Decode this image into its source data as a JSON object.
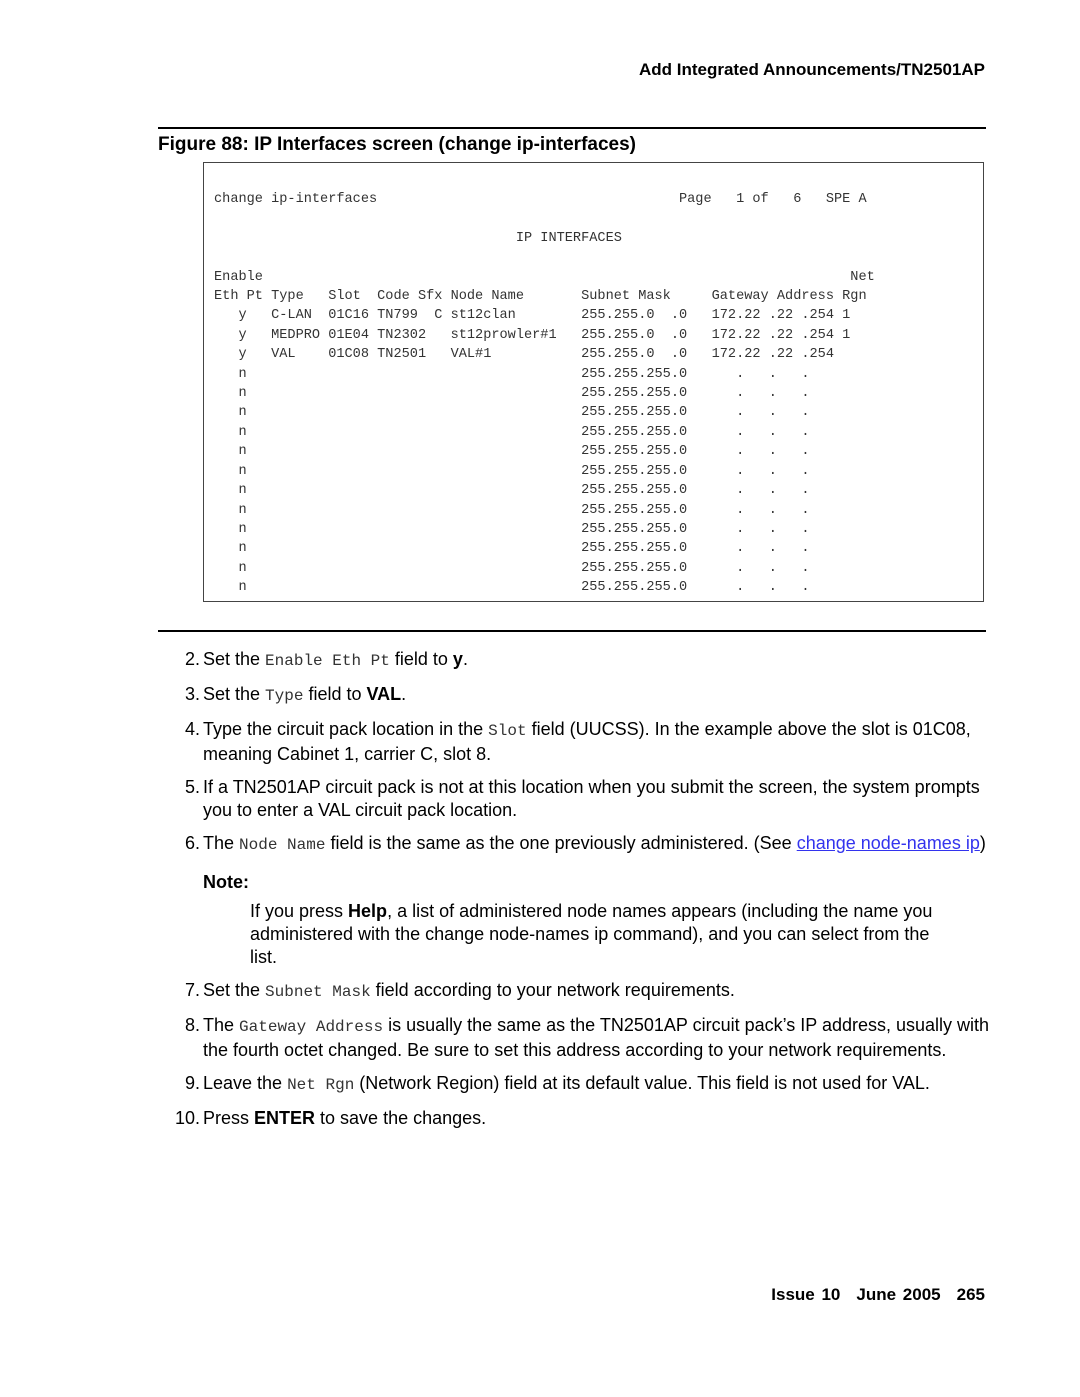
{
  "header": {
    "running_title": "Add Integrated Announcements/TN2501AP"
  },
  "figure": {
    "title": "Figure 88: IP Interfaces screen (change ip-interfaces)"
  },
  "screen": {
    "lines": [
      "change ip-interfaces                                     Page   1 of   6   SPE A",
      "",
      "                                     IP INTERFACES",
      "",
      "Enable                                                                        Net",
      "Eth Pt Type   Slot  Code Sfx Node Name       Subnet Mask     Gateway Address Rgn",
      "   y   C-LAN  01C16 TN799  C st12clan        255.255.0  .0   172.22 .22 .254 1",
      "   y   MEDPRO 01E04 TN2302   st12prowler#1   255.255.0  .0   172.22 .22 .254 1",
      "   y   VAL    01C08 TN2501   VAL#1           255.255.0  .0   172.22 .22 .254",
      "   n                                         255.255.255.0      .   .   .",
      "   n                                         255.255.255.0      .   .   .",
      "   n                                         255.255.255.0      .   .   .",
      "   n                                         255.255.255.0      .   .   .",
      "   n                                         255.255.255.0      .   .   .",
      "   n                                         255.255.255.0      .   .   .",
      "   n                                         255.255.255.0      .   .   .",
      "   n                                         255.255.255.0      .   .   .",
      "   n                                         255.255.255.0      .   .   .",
      "   n                                         255.255.255.0      .   .   .",
      "   n                                         255.255.255.0      .   .   .",
      "   n                                         255.255.255.0      .   .   ."
    ]
  },
  "steps": {
    "s2": {
      "num": "2.",
      "a": "Set the ",
      "code": "Enable Eth Pt",
      "b": " field to ",
      "bold": "y",
      "c": "."
    },
    "s3": {
      "num": "3.",
      "a": "Set the ",
      "code": "Type",
      "b": " field to ",
      "bold": "VAL",
      "c": "."
    },
    "s4": {
      "num": "4.",
      "a": "Type the circuit pack location in the ",
      "code": "Slot",
      "b": " field (UUCSS). In the example above the slot is 01C08, meaning Cabinet 1, carrier C, slot 8."
    },
    "s5": {
      "num": "5.",
      "a": "If a TN2501AP circuit pack is not at this location when you submit the screen, the system prompts you to enter a VAL circuit pack location."
    },
    "s6": {
      "num": "6.",
      "a": "The ",
      "code": "Node Name",
      "b": " field is the same as the one previously administered. (See ",
      "link": "change node-names ip",
      "c": ")"
    },
    "note": {
      "label": "Note:",
      "a": "If you press ",
      "bold": "Help",
      "b": ", a list of administered node names appears (including the name you administered with the change node-names ip command), and you can select from the list."
    },
    "s7": {
      "num": "7.",
      "a": "Set the ",
      "code": "Subnet Mask",
      "b": " field according to your network requirements."
    },
    "s8": {
      "num": "8.",
      "a": "The ",
      "code": "Gateway Address",
      "b": " is usually the same as the TN2501AP circuit pack’s IP address, usually with the fourth octet changed. Be sure to set this address according to your network requirements."
    },
    "s9": {
      "num": "9.",
      "a": "Leave the ",
      "code": "Net Rgn",
      "b": " (Network Region) field at its default value. This field is not used for VAL."
    },
    "s10": {
      "num": "10.",
      "a": "Press ",
      "bold": "ENTER",
      "b": " to save the changes."
    }
  },
  "footer": {
    "issue": "Issue 10",
    "date": "June 2005",
    "page": "265"
  },
  "colors": {
    "link": "#3333ee"
  }
}
